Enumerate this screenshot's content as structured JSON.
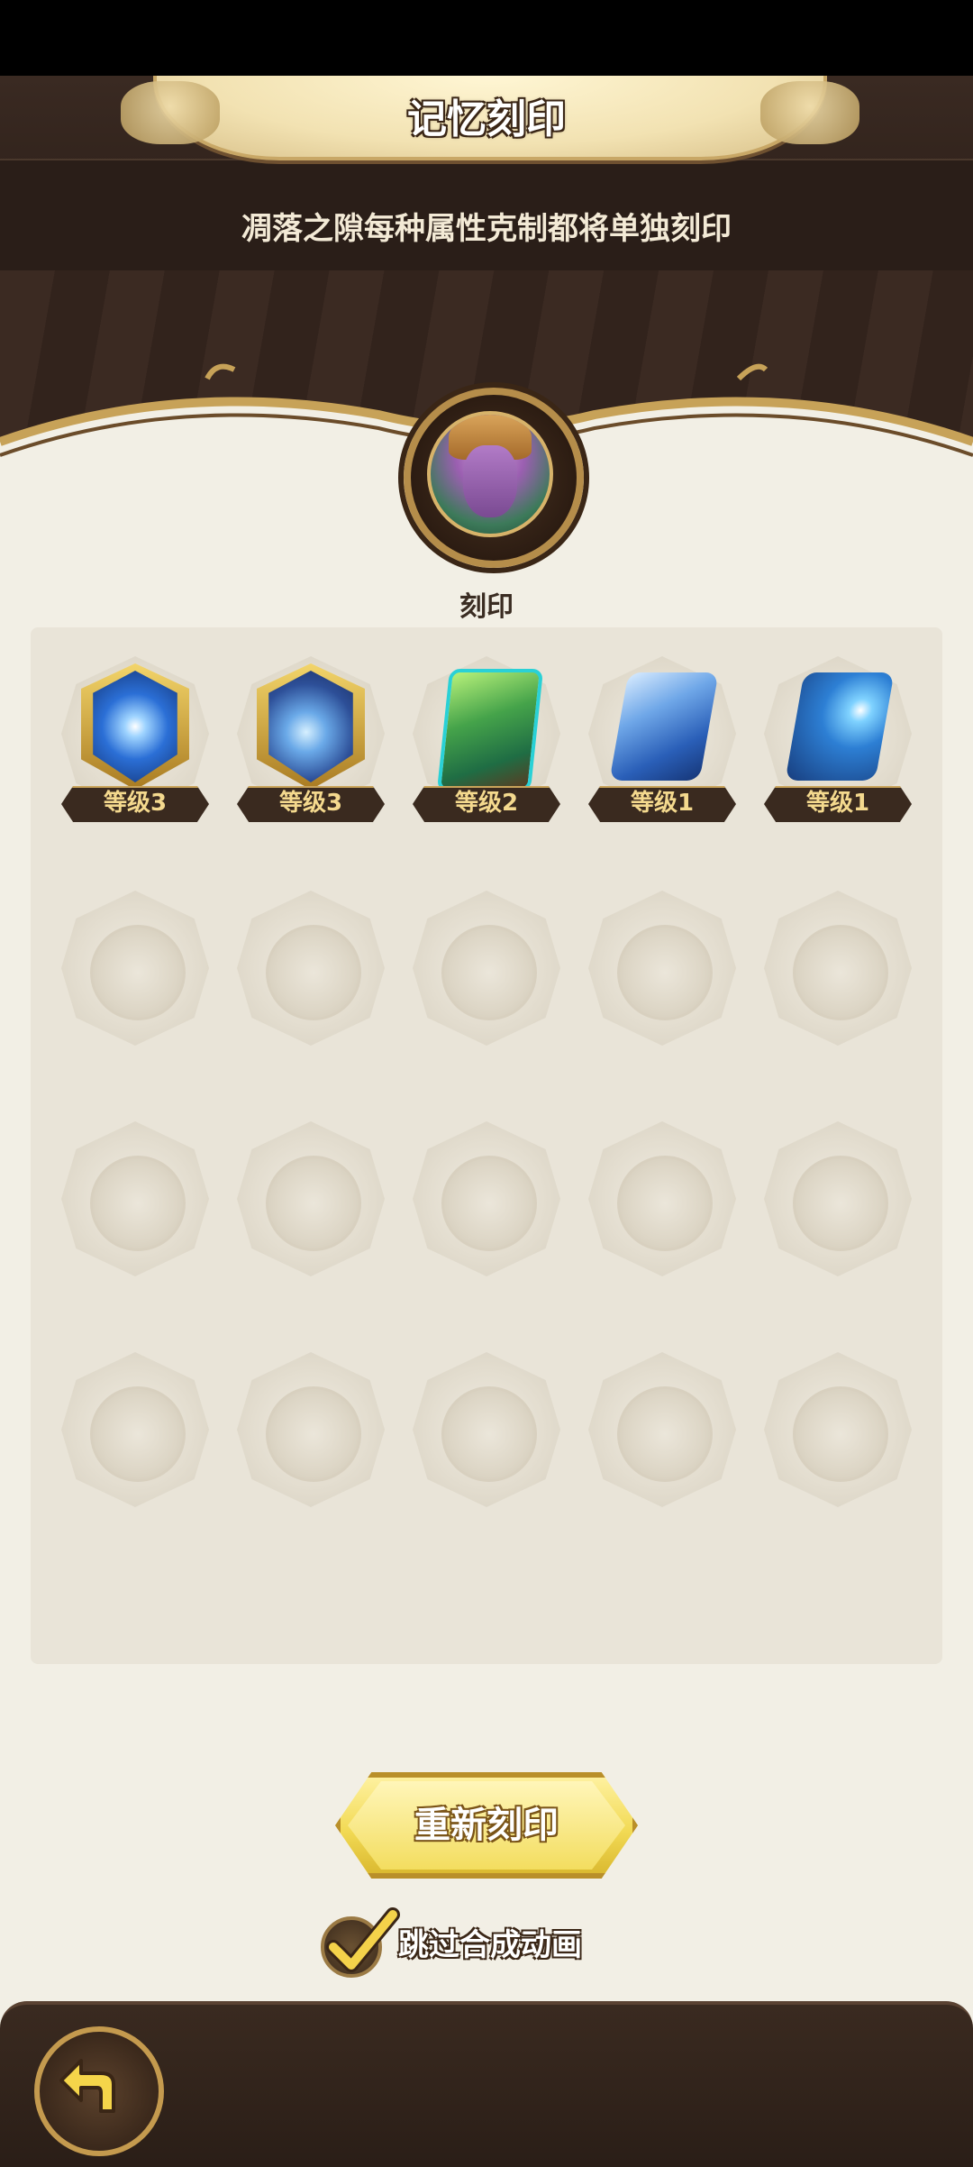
{
  "header": {
    "title": "记忆刻印",
    "subtitle": "凋落之隙每种属性克制都将单独刻印"
  },
  "hero": {
    "label": "刻印"
  },
  "grid": {
    "filled": [
      {
        "level": "等级3",
        "type": "electric-orb-gem"
      },
      {
        "level": "等级3",
        "type": "storm-gem"
      },
      {
        "level": "等级2",
        "type": "nature-card"
      },
      {
        "level": "等级1",
        "type": "water-creature-card"
      },
      {
        "level": "等级1",
        "type": "water-orb-card"
      }
    ],
    "empty_slots": 15
  },
  "actions": {
    "reimprint_label": "重新刻印",
    "skip_animation_label": "跳过合成动画",
    "skip_animation_checked": true
  },
  "colors": {
    "accent_gold": "#f2da55",
    "dark_brown": "#2a1e17",
    "panel_bg": "#e9e4d8"
  },
  "icons": {
    "back": "back-arrow-icon",
    "check": "checkmark-icon"
  }
}
